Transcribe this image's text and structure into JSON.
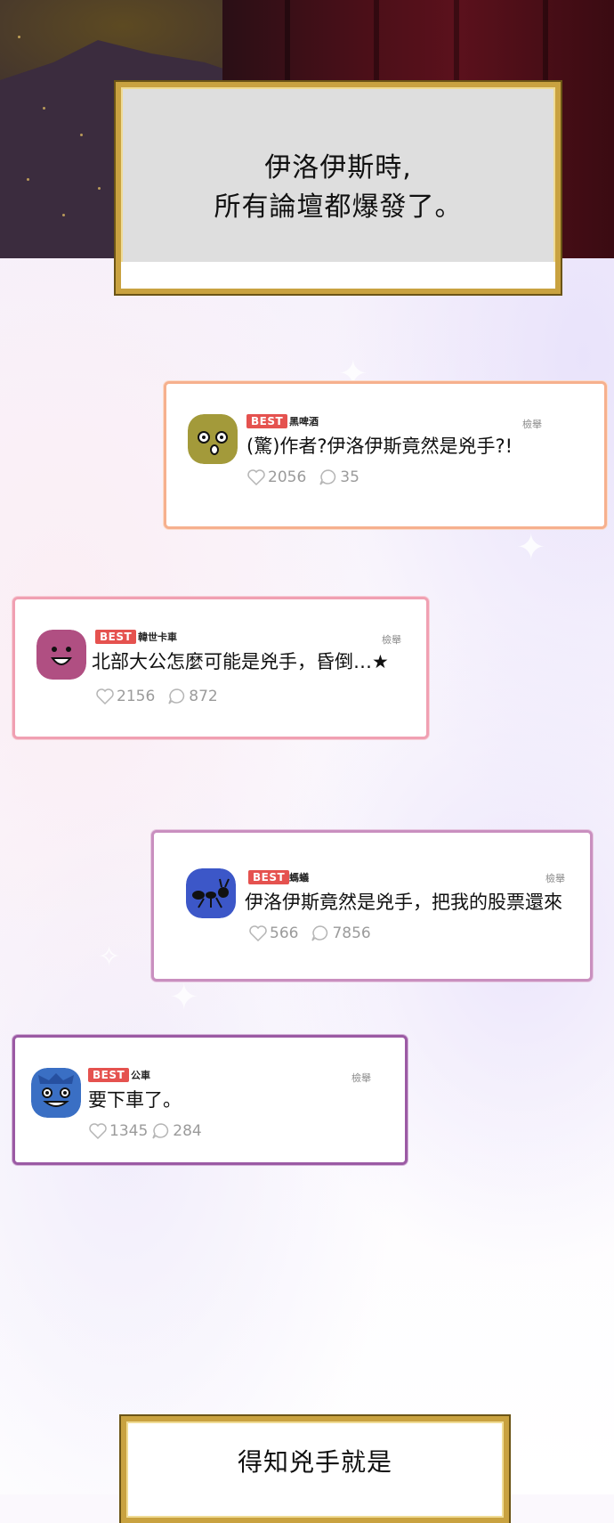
{
  "captions": {
    "top": {
      "line1": "伊洛伊斯時,",
      "line2": "所有論壇都爆發了。"
    },
    "bottom": {
      "line1": "得知兇手就是"
    }
  },
  "comments": [
    {
      "badge": "BEST",
      "user": "黑啤酒",
      "report": "檢舉",
      "text": "(驚)作者?伊洛伊斯竟然是兇手?!",
      "likes": "2056",
      "replies": "35",
      "avatar": "olive-face-icon",
      "color": "#a39a3a"
    },
    {
      "badge": "BEST",
      "user": "韓世卡車",
      "report": "檢舉",
      "text": "北部大公怎麼可能是兇手，昏倒…★",
      "likes": "2156",
      "replies": "872",
      "avatar": "pink-face-icon",
      "color": "#b04f82"
    },
    {
      "badge": "BEST",
      "user": "螞蟻",
      "report": "檢舉",
      "text": "伊洛伊斯竟然是兇手，把我的股票還來",
      "likes": "566",
      "replies": "7856",
      "avatar": "ant-icon",
      "color": "#3c57c8"
    },
    {
      "badge": "BEST",
      "user": "公車",
      "report": "檢舉",
      "text": "要下車了。",
      "likes": "1345",
      "replies": "284",
      "avatar": "blue-face-icon",
      "color": "#3a6fc4"
    }
  ]
}
